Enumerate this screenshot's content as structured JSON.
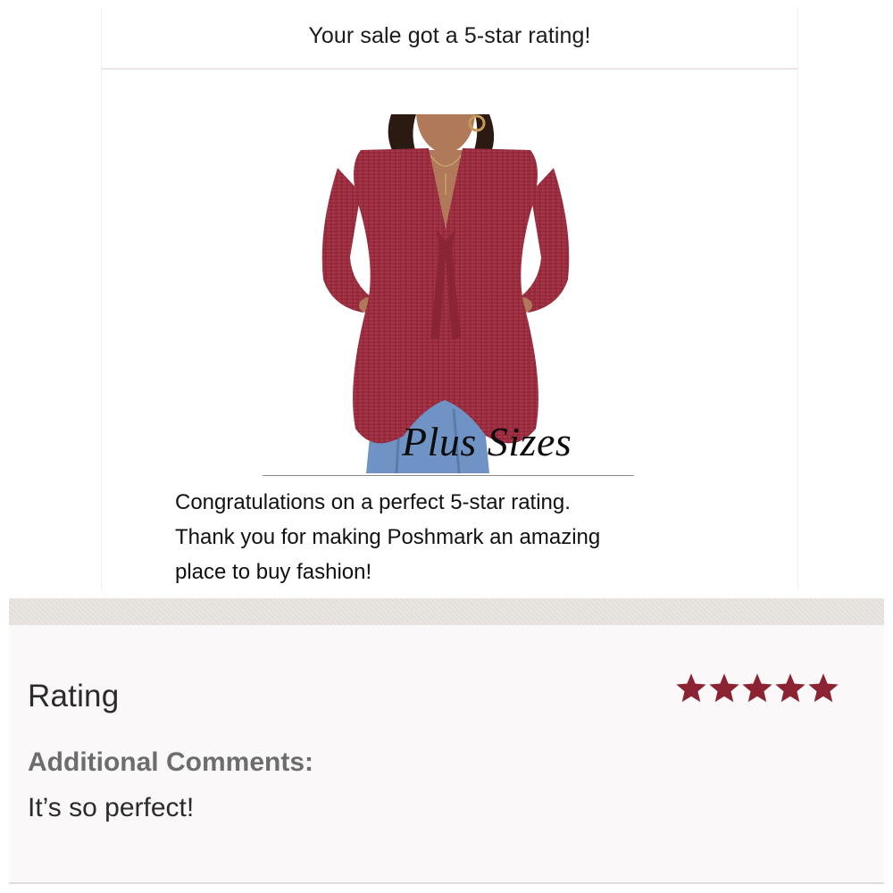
{
  "email": {
    "header": "Your sale got a 5-star rating!",
    "photo_overlay_text": "Plus Sizes",
    "message_lines": [
      "Congratulations on a perfect 5-star rating.",
      "Thank you for making Poshmark an amazing",
      "place to buy fashion!"
    ]
  },
  "rating": {
    "label": "Rating",
    "stars_filled": 5,
    "stars_total": 5,
    "star_icon": "star-icon",
    "comments_label": "Additional Comments:",
    "comments_text": "It’s so perfect!"
  },
  "colors": {
    "star": "#8c2332",
    "top": "#9e2f3e",
    "jeans": "#6f93c4",
    "skin": "#b07a5a",
    "hair": "#2a1a12"
  }
}
